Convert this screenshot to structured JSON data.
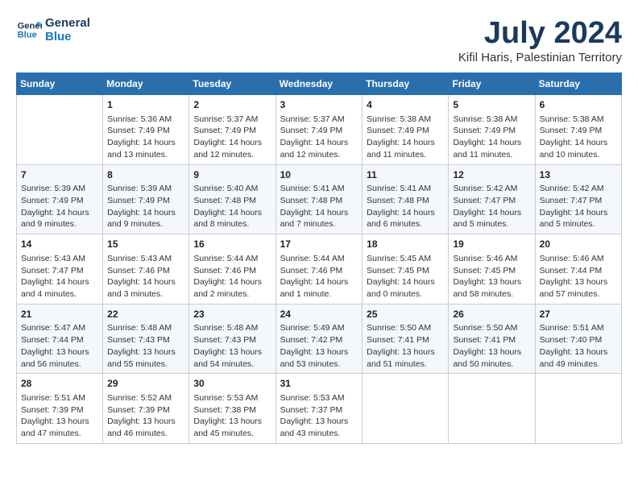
{
  "logo": {
    "line1": "General",
    "line2": "Blue"
  },
  "title": "July 2024",
  "location": "Kifil Haris, Palestinian Territory",
  "days_of_week": [
    "Sunday",
    "Monday",
    "Tuesday",
    "Wednesday",
    "Thursday",
    "Friday",
    "Saturday"
  ],
  "weeks": [
    [
      {
        "day": "",
        "info": ""
      },
      {
        "day": "1",
        "info": "Sunrise: 5:36 AM\nSunset: 7:49 PM\nDaylight: 14 hours\nand 13 minutes."
      },
      {
        "day": "2",
        "info": "Sunrise: 5:37 AM\nSunset: 7:49 PM\nDaylight: 14 hours\nand 12 minutes."
      },
      {
        "day": "3",
        "info": "Sunrise: 5:37 AM\nSunset: 7:49 PM\nDaylight: 14 hours\nand 12 minutes."
      },
      {
        "day": "4",
        "info": "Sunrise: 5:38 AM\nSunset: 7:49 PM\nDaylight: 14 hours\nand 11 minutes."
      },
      {
        "day": "5",
        "info": "Sunrise: 5:38 AM\nSunset: 7:49 PM\nDaylight: 14 hours\nand 11 minutes."
      },
      {
        "day": "6",
        "info": "Sunrise: 5:38 AM\nSunset: 7:49 PM\nDaylight: 14 hours\nand 10 minutes."
      }
    ],
    [
      {
        "day": "7",
        "info": "Sunrise: 5:39 AM\nSunset: 7:49 PM\nDaylight: 14 hours\nand 9 minutes."
      },
      {
        "day": "8",
        "info": "Sunrise: 5:39 AM\nSunset: 7:49 PM\nDaylight: 14 hours\nand 9 minutes."
      },
      {
        "day": "9",
        "info": "Sunrise: 5:40 AM\nSunset: 7:48 PM\nDaylight: 14 hours\nand 8 minutes."
      },
      {
        "day": "10",
        "info": "Sunrise: 5:41 AM\nSunset: 7:48 PM\nDaylight: 14 hours\nand 7 minutes."
      },
      {
        "day": "11",
        "info": "Sunrise: 5:41 AM\nSunset: 7:48 PM\nDaylight: 14 hours\nand 6 minutes."
      },
      {
        "day": "12",
        "info": "Sunrise: 5:42 AM\nSunset: 7:47 PM\nDaylight: 14 hours\nand 5 minutes."
      },
      {
        "day": "13",
        "info": "Sunrise: 5:42 AM\nSunset: 7:47 PM\nDaylight: 14 hours\nand 5 minutes."
      }
    ],
    [
      {
        "day": "14",
        "info": "Sunrise: 5:43 AM\nSunset: 7:47 PM\nDaylight: 14 hours\nand 4 minutes."
      },
      {
        "day": "15",
        "info": "Sunrise: 5:43 AM\nSunset: 7:46 PM\nDaylight: 14 hours\nand 3 minutes."
      },
      {
        "day": "16",
        "info": "Sunrise: 5:44 AM\nSunset: 7:46 PM\nDaylight: 14 hours\nand 2 minutes."
      },
      {
        "day": "17",
        "info": "Sunrise: 5:44 AM\nSunset: 7:46 PM\nDaylight: 14 hours\nand 1 minute."
      },
      {
        "day": "18",
        "info": "Sunrise: 5:45 AM\nSunset: 7:45 PM\nDaylight: 14 hours\nand 0 minutes."
      },
      {
        "day": "19",
        "info": "Sunrise: 5:46 AM\nSunset: 7:45 PM\nDaylight: 13 hours\nand 58 minutes."
      },
      {
        "day": "20",
        "info": "Sunrise: 5:46 AM\nSunset: 7:44 PM\nDaylight: 13 hours\nand 57 minutes."
      }
    ],
    [
      {
        "day": "21",
        "info": "Sunrise: 5:47 AM\nSunset: 7:44 PM\nDaylight: 13 hours\nand 56 minutes."
      },
      {
        "day": "22",
        "info": "Sunrise: 5:48 AM\nSunset: 7:43 PM\nDaylight: 13 hours\nand 55 minutes."
      },
      {
        "day": "23",
        "info": "Sunrise: 5:48 AM\nSunset: 7:43 PM\nDaylight: 13 hours\nand 54 minutes."
      },
      {
        "day": "24",
        "info": "Sunrise: 5:49 AM\nSunset: 7:42 PM\nDaylight: 13 hours\nand 53 minutes."
      },
      {
        "day": "25",
        "info": "Sunrise: 5:50 AM\nSunset: 7:41 PM\nDaylight: 13 hours\nand 51 minutes."
      },
      {
        "day": "26",
        "info": "Sunrise: 5:50 AM\nSunset: 7:41 PM\nDaylight: 13 hours\nand 50 minutes."
      },
      {
        "day": "27",
        "info": "Sunrise: 5:51 AM\nSunset: 7:40 PM\nDaylight: 13 hours\nand 49 minutes."
      }
    ],
    [
      {
        "day": "28",
        "info": "Sunrise: 5:51 AM\nSunset: 7:39 PM\nDaylight: 13 hours\nand 47 minutes."
      },
      {
        "day": "29",
        "info": "Sunrise: 5:52 AM\nSunset: 7:39 PM\nDaylight: 13 hours\nand 46 minutes."
      },
      {
        "day": "30",
        "info": "Sunrise: 5:53 AM\nSunset: 7:38 PM\nDaylight: 13 hours\nand 45 minutes."
      },
      {
        "day": "31",
        "info": "Sunrise: 5:53 AM\nSunset: 7:37 PM\nDaylight: 13 hours\nand 43 minutes."
      },
      {
        "day": "",
        "info": ""
      },
      {
        "day": "",
        "info": ""
      },
      {
        "day": "",
        "info": ""
      }
    ]
  ]
}
